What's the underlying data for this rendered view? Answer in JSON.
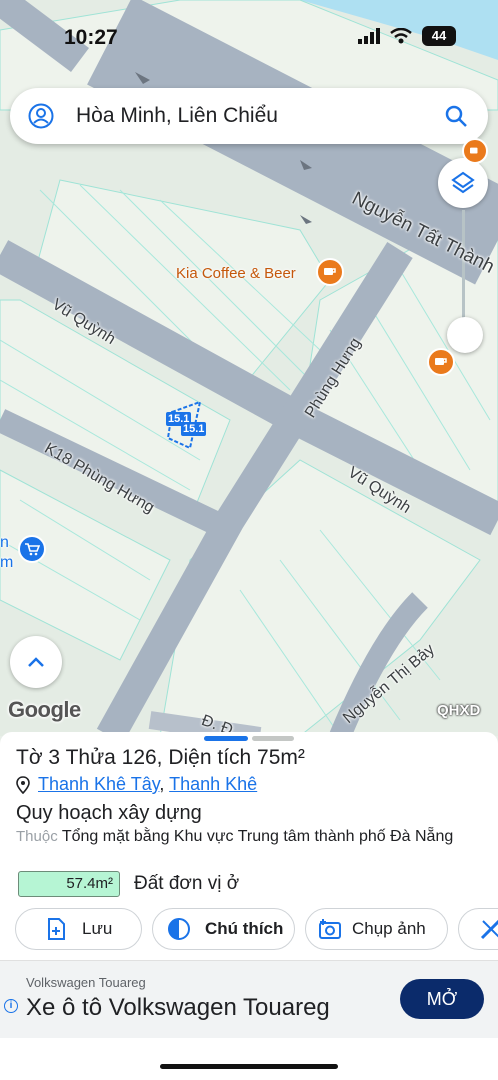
{
  "status_bar": {
    "time": "10:27",
    "battery": "44"
  },
  "search": {
    "query": "Hòa Minh, Liên Chiểu"
  },
  "map": {
    "streets": [
      "Nguyễn Tất Thành",
      "Vũ Quỳnh",
      "Phùng Hưng",
      "Vũ Quỳnh",
      "K18 Phùng Hưng",
      "Nguyễn Thị Bảy",
      "Đ. Đ"
    ],
    "poi": "Kia Coffee & Beer",
    "parcel_labels": [
      "15.1",
      "15.1"
    ],
    "edge_labels": [
      "n",
      "m"
    ],
    "attribution": "Google",
    "layer_code": "QHXD"
  },
  "sheet": {
    "title": "Tờ 3 Thửa 126, Diện tích 75m²",
    "ward": "Thanh Khê Tây",
    "separator": ",",
    "district": "Thanh Khê",
    "plan_type": "Quy hoạch xây dựng",
    "belongs_label": "Thuộc",
    "belongs_value": "Tổng mặt bằng Khu vực Trung tâm thành phố Đà Nẵng",
    "area_value": "57.4m²",
    "area_type": "Đất đơn vị ở",
    "zone_color": "#b6f5d4",
    "actions": [
      {
        "label": "Lưu",
        "icon": "add-file-icon"
      },
      {
        "label": "Chú thích",
        "icon": "contrast-icon"
      },
      {
        "label": "Chụp ảnh",
        "icon": "camera-icon"
      },
      {
        "label": "",
        "icon": "ruler-icon"
      }
    ]
  },
  "ad": {
    "brand": "Volkswagen Touareg",
    "headline": "Xe ô tô Volkswagen Touareg",
    "cta": "MỞ",
    "info_glyph": "i"
  },
  "colors": {
    "accent": "#1a73e8",
    "poi": "#ea7a1c",
    "cta": "#0b2b6b"
  }
}
